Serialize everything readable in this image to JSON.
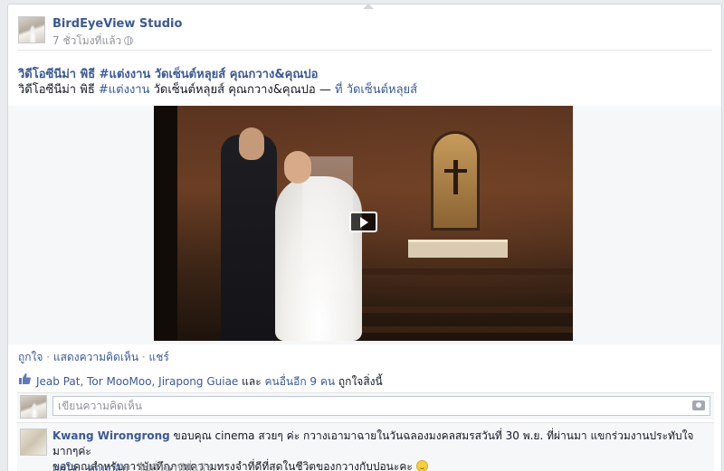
{
  "post": {
    "author": "BirdEyeView Studio",
    "time": "7 ชั่วโมงที่แล้ว",
    "title": "วิดีโอซีนีม่า พิธี #แต่งงาน วัดเซ็นต์หลุยส์ คุณกวาง&คุณปอ",
    "description": {
      "prefix": "วิดีโอซีนีม่า พิธี ",
      "hashtag": "#แต่งงาน",
      "middle": " วัดเซ็นต์หลุยส์ คุณกวาง&คุณปอ — ",
      "at": "ที่ ",
      "place": "วัดเซ็นต์หลุยส์"
    }
  },
  "actions": {
    "like": "ถูกใจ",
    "comment": "แสดงความคิดเห็น",
    "share": "แชร์",
    "separator": " · "
  },
  "likes": {
    "names": "Jeab Pat, Tor MooMoo, Jirapong Guiae",
    "and": " และ ",
    "others": "คนอื่นอีก 9 คน",
    "suffix": " ถูกใจสิ่งนี้"
  },
  "comment_input": {
    "placeholder": "เขียนความคิดเห็น"
  },
  "comment": {
    "author": "Kwang Wirongrong",
    "text_line1": " ขอบคุณ cinema สวยๆ ค่ะ กวางเอามาฉายในวันฉลองมงคลสมรสวันที่ 30 พ.ย. ที่ผ่านมา แขกร่วมงานประทับใจมากๆค่ะ",
    "text_line2": "ขอบคุณสำหรับการบันทึกภาพความทรงจำที่ดีที่สุดในชีวิตของกวางกับปอนะคะ ",
    "like": "ถูกใจ",
    "reply": "ตอบกลับ",
    "time": "ไม่กี่วินาทีที่แล้ว",
    "separator": " · "
  },
  "icons": {
    "privacy": "globe-icon",
    "play": "play-icon",
    "like": "thumbs-up-icon",
    "camera": "camera-icon",
    "emoji": "smile-icon"
  },
  "colors": {
    "link": "#3b5998",
    "meta": "#90949c",
    "background": "#e9ebee"
  }
}
